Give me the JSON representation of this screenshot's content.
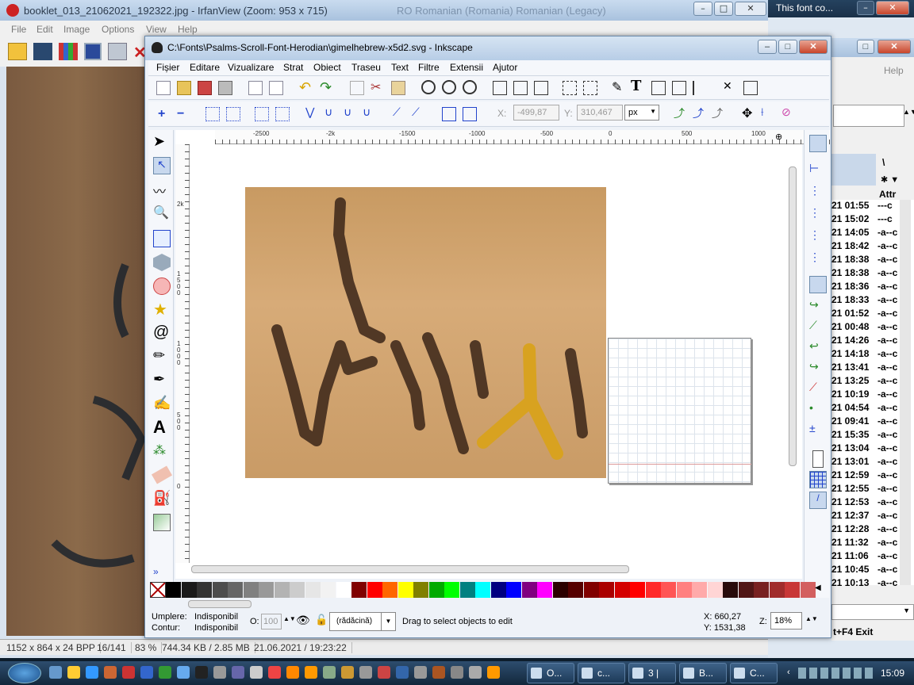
{
  "irfan": {
    "title": "booklet_013_21062021_192322.jpg - IrfanView (Zoom: 953 x 715)",
    "ghost_title": "RO Romanian (Romania)   Romanian (Legacy)",
    "menu": [
      "File",
      "Edit",
      "Image",
      "Options",
      "View",
      "Help"
    ],
    "status": [
      "1152 x 864 x 24 BPP",
      "16/141",
      "83 %",
      "744.34 KB / 2.85 MB",
      "21.06.2021 / 19:23:22"
    ]
  },
  "right_window": {
    "title": "This font co...",
    "help": "Help",
    "col1": "\\",
    "col2": "Attr",
    "times": [
      "21 01:55",
      "21 15:02",
      "21 14:05",
      "21 18:42",
      "21 18:38",
      "21 18:38",
      "21 18:36",
      "21 18:33",
      "21 01:52",
      "21 00:48",
      "21 14:26",
      "21 14:18",
      "21 13:41",
      "21 13:25",
      "21 10:19",
      "21 04:54",
      "21 09:41",
      "21 15:35",
      "21 13:04",
      "21 13:01",
      "21 12:59",
      "21 12:55",
      "21 12:53",
      "21 12:37",
      "21 12:28",
      "21 11:32",
      "21 11:06",
      "21 10:45",
      "21 10:13"
    ],
    "attrs": [
      "---c",
      "---c",
      "-a--c",
      "-a--c",
      "-a--c",
      "-a--c",
      "-a--c",
      "-a--c",
      "-a--c",
      "-a--c",
      "-a--c",
      "-a--c",
      "-a--c",
      "-a--c",
      "-a--c",
      "-a--c",
      "-a--c",
      "-a--c",
      "-a--c",
      "-a--c",
      "-a--c",
      "-a--c",
      "-a--c",
      "-a--c",
      "-a--c",
      "-a--c",
      "-a--c",
      "-a--c",
      "-a--c"
    ],
    "footer": "t+F4 Exit"
  },
  "inkscape": {
    "title": "C:\\Fonts\\Psalms-Scroll-Font-Herodian\\gimelhebrew-x5d2.svg - Inkscape",
    "menu": [
      {
        "label": "Fișier"
      },
      {
        "label": "Editare"
      },
      {
        "label": "Vizualizare"
      },
      {
        "label": "Strat"
      },
      {
        "label": "Obiect"
      },
      {
        "label": "Traseu"
      },
      {
        "label": "Text"
      },
      {
        "label": "Filtre"
      },
      {
        "label": "Extensii"
      },
      {
        "label": "Ajutor"
      }
    ],
    "coord_x_label": "X:",
    "coord_x": "-499,87",
    "coord_y_label": "Y:",
    "coord_y": "310,467",
    "unit": "px",
    "hruler_ticks": [
      "-2500",
      "-2k",
      "-1500",
      "-1000",
      "-500",
      "0",
      "500",
      "1000"
    ],
    "vruler_ticks": [
      "2k",
      "1500",
      "1000",
      "500",
      "0"
    ],
    "fill_label": "Umplere:",
    "fill_value": "Indisponibil",
    "stroke_label": "Contur:",
    "stroke_value": "Indisponibil",
    "opacity_label": "O:",
    "opacity_value": "100",
    "layer": "(rădăcină)",
    "status_msg": "Drag to select objects to edit",
    "cursor_x": "X:  660,27",
    "cursor_y": "Y: 1531,38",
    "zoom_label": "Z:",
    "zoom": "18%"
  },
  "palette_colors": [
    "#000000",
    "#1a1a1a",
    "#333333",
    "#4d4d4d",
    "#666666",
    "#808080",
    "#999999",
    "#b3b3b3",
    "#cccccc",
    "#e6e6e6",
    "#f2f2f2",
    "#ffffff",
    "#800000",
    "#ff0000",
    "#ff6600",
    "#ffff00",
    "#808000",
    "#00aa00",
    "#00ff00",
    "#008080",
    "#00ffff",
    "#000080",
    "#0000ff",
    "#800080",
    "#ff00ff",
    "#2b0000",
    "#550000",
    "#800000",
    "#aa0000",
    "#d40000",
    "#ff0000",
    "#ff2a2a",
    "#ff5555",
    "#ff8080",
    "#ffaaaa",
    "#ffd5d5",
    "#280b0b",
    "#501616",
    "#782121",
    "#a02c2c",
    "#c83737",
    "#d35f5f"
  ],
  "taskbar": {
    "items": [
      "O...",
      "c...",
      "3 |",
      "B...",
      "C..."
    ],
    "clock": "15:09"
  }
}
